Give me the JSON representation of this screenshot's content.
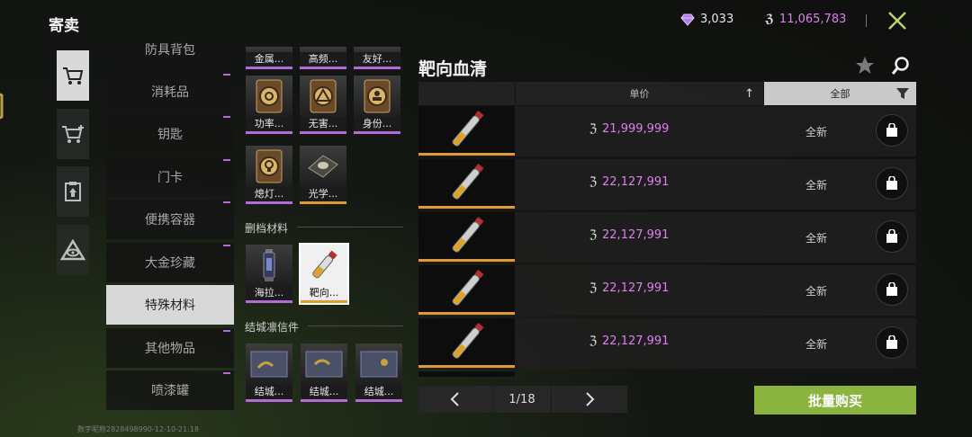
{
  "header": {
    "title": "寄卖",
    "gems": "3,033",
    "coins": "11,065,783"
  },
  "categories": {
    "partial_top": "防具背包",
    "items": [
      "消耗品",
      "钥匙",
      "门卡",
      "便携容器",
      "大金珍藏",
      "特殊材料",
      "其他物品",
      "喷漆罐"
    ],
    "active_index": 5
  },
  "grid": {
    "top_partial": [
      "金属...",
      "高频...",
      "友好..."
    ],
    "row1": [
      "功率...",
      "无害...",
      "身份..."
    ],
    "row2": [
      "熄灯...",
      "光学..."
    ],
    "section_delete": "删档材料",
    "delete_items": [
      "海拉...",
      "靶向..."
    ],
    "section_letters": "结城凛信件",
    "letter_items": [
      "结城...",
      "结城...",
      "结城..."
    ]
  },
  "panel": {
    "title": "靶向血清",
    "col_price": "单价",
    "col_filter": "全部",
    "condition": "全新",
    "prices": [
      "21,999,999",
      "22,127,991",
      "22,127,991",
      "22,127,991",
      "22,127,991"
    ]
  },
  "pager": {
    "page": "1/18"
  },
  "bulk_buy": "批量购买",
  "footer": "数字昵称2828498990-12-10-21:18",
  "colors": {
    "accent": "#8ab43e",
    "price": "#e07ef0",
    "rarity": "#b56ad9",
    "selected": "#e09a33"
  }
}
